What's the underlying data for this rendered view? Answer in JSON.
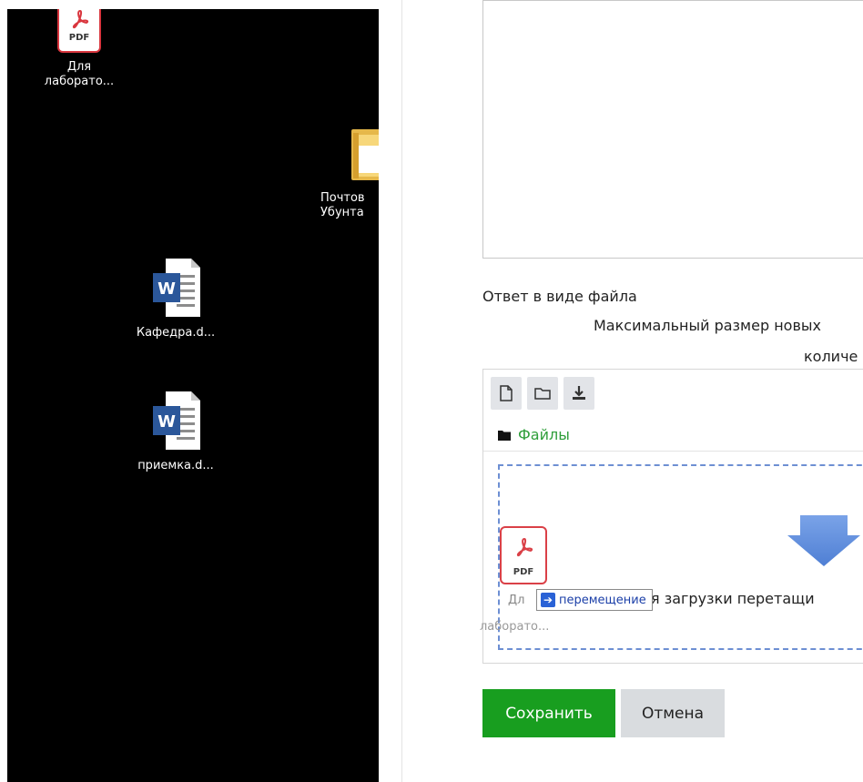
{
  "desktop": {
    "icons": [
      {
        "label_line1": "Для",
        "label_line2": "лаборато...",
        "icon": "pdf-file-icon"
      },
      {
        "label_line1": "Почтов",
        "label_line2": "Убунта",
        "icon": "folder-icon"
      },
      {
        "label_line1": "Кафедра.d...",
        "icon": "word-file-icon"
      },
      {
        "label_line1": "приемка.d...",
        "icon": "word-file-icon"
      }
    ]
  },
  "form": {
    "section_label": "Ответ в виде файла",
    "max_size_text": "Максимальный размер новых",
    "count_text": "количе",
    "folder_path": "Файлы",
    "drop_text": "я загрузки перетащи",
    "pdf_badge": "PDF"
  },
  "drag": {
    "tooltip": "перемещение",
    "label1": "Дл",
    "label2": "лаборато..."
  },
  "buttons": {
    "save": "Сохранить",
    "cancel": "Отмена"
  },
  "colors": {
    "save_bg": "#189e1f",
    "path_green": "#2f9e3a",
    "drop_border": "#6d8fd3"
  }
}
